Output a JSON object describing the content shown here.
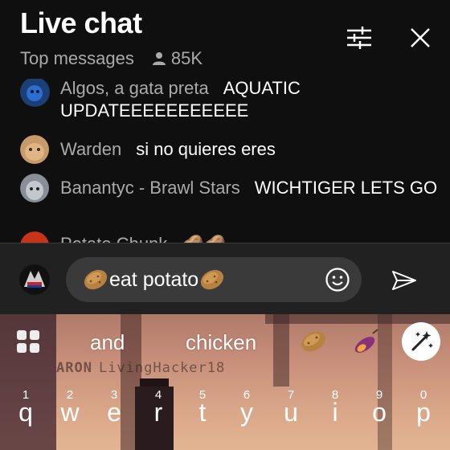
{
  "header": {
    "title": "Live chat",
    "subtitle": "Top messages",
    "viewer_count": "85K"
  },
  "messages": [
    {
      "author": "Algos, a gata preta",
      "text": "AQUATIC UPDATEEEEEEEEEEE"
    },
    {
      "author": "Warden",
      "text": "si no quieres eres"
    },
    {
      "author": "Banantyc - Brawl Stars",
      "text": "WICHTIGER LETS GO"
    },
    {
      "author": "Potato Chunk",
      "text": "🥔🥔"
    }
  ],
  "input": {
    "text": "eat potato",
    "prefix_emoji": "potato-emoji",
    "suffix_emoji": "potato-emoji"
  },
  "keyboard": {
    "suggestions": [
      "and",
      "chicken"
    ],
    "emoji_suggestions": [
      "potato-emoji",
      "sweet-potato-emoji"
    ],
    "background_overlay": {
      "tag": "ARON",
      "name": "LivingHacker18"
    },
    "keys": [
      {
        "num": "1",
        "ch": "q"
      },
      {
        "num": "2",
        "ch": "w"
      },
      {
        "num": "3",
        "ch": "e"
      },
      {
        "num": "4",
        "ch": "r"
      },
      {
        "num": "5",
        "ch": "t"
      },
      {
        "num": "6",
        "ch": "y"
      },
      {
        "num": "7",
        "ch": "u"
      },
      {
        "num": "8",
        "ch": "i"
      },
      {
        "num": "9",
        "ch": "o"
      },
      {
        "num": "0",
        "ch": "p"
      }
    ]
  },
  "colors": {
    "background": "#0f0f0f",
    "input_bar": "#212121",
    "author": "#aaaaaa"
  }
}
